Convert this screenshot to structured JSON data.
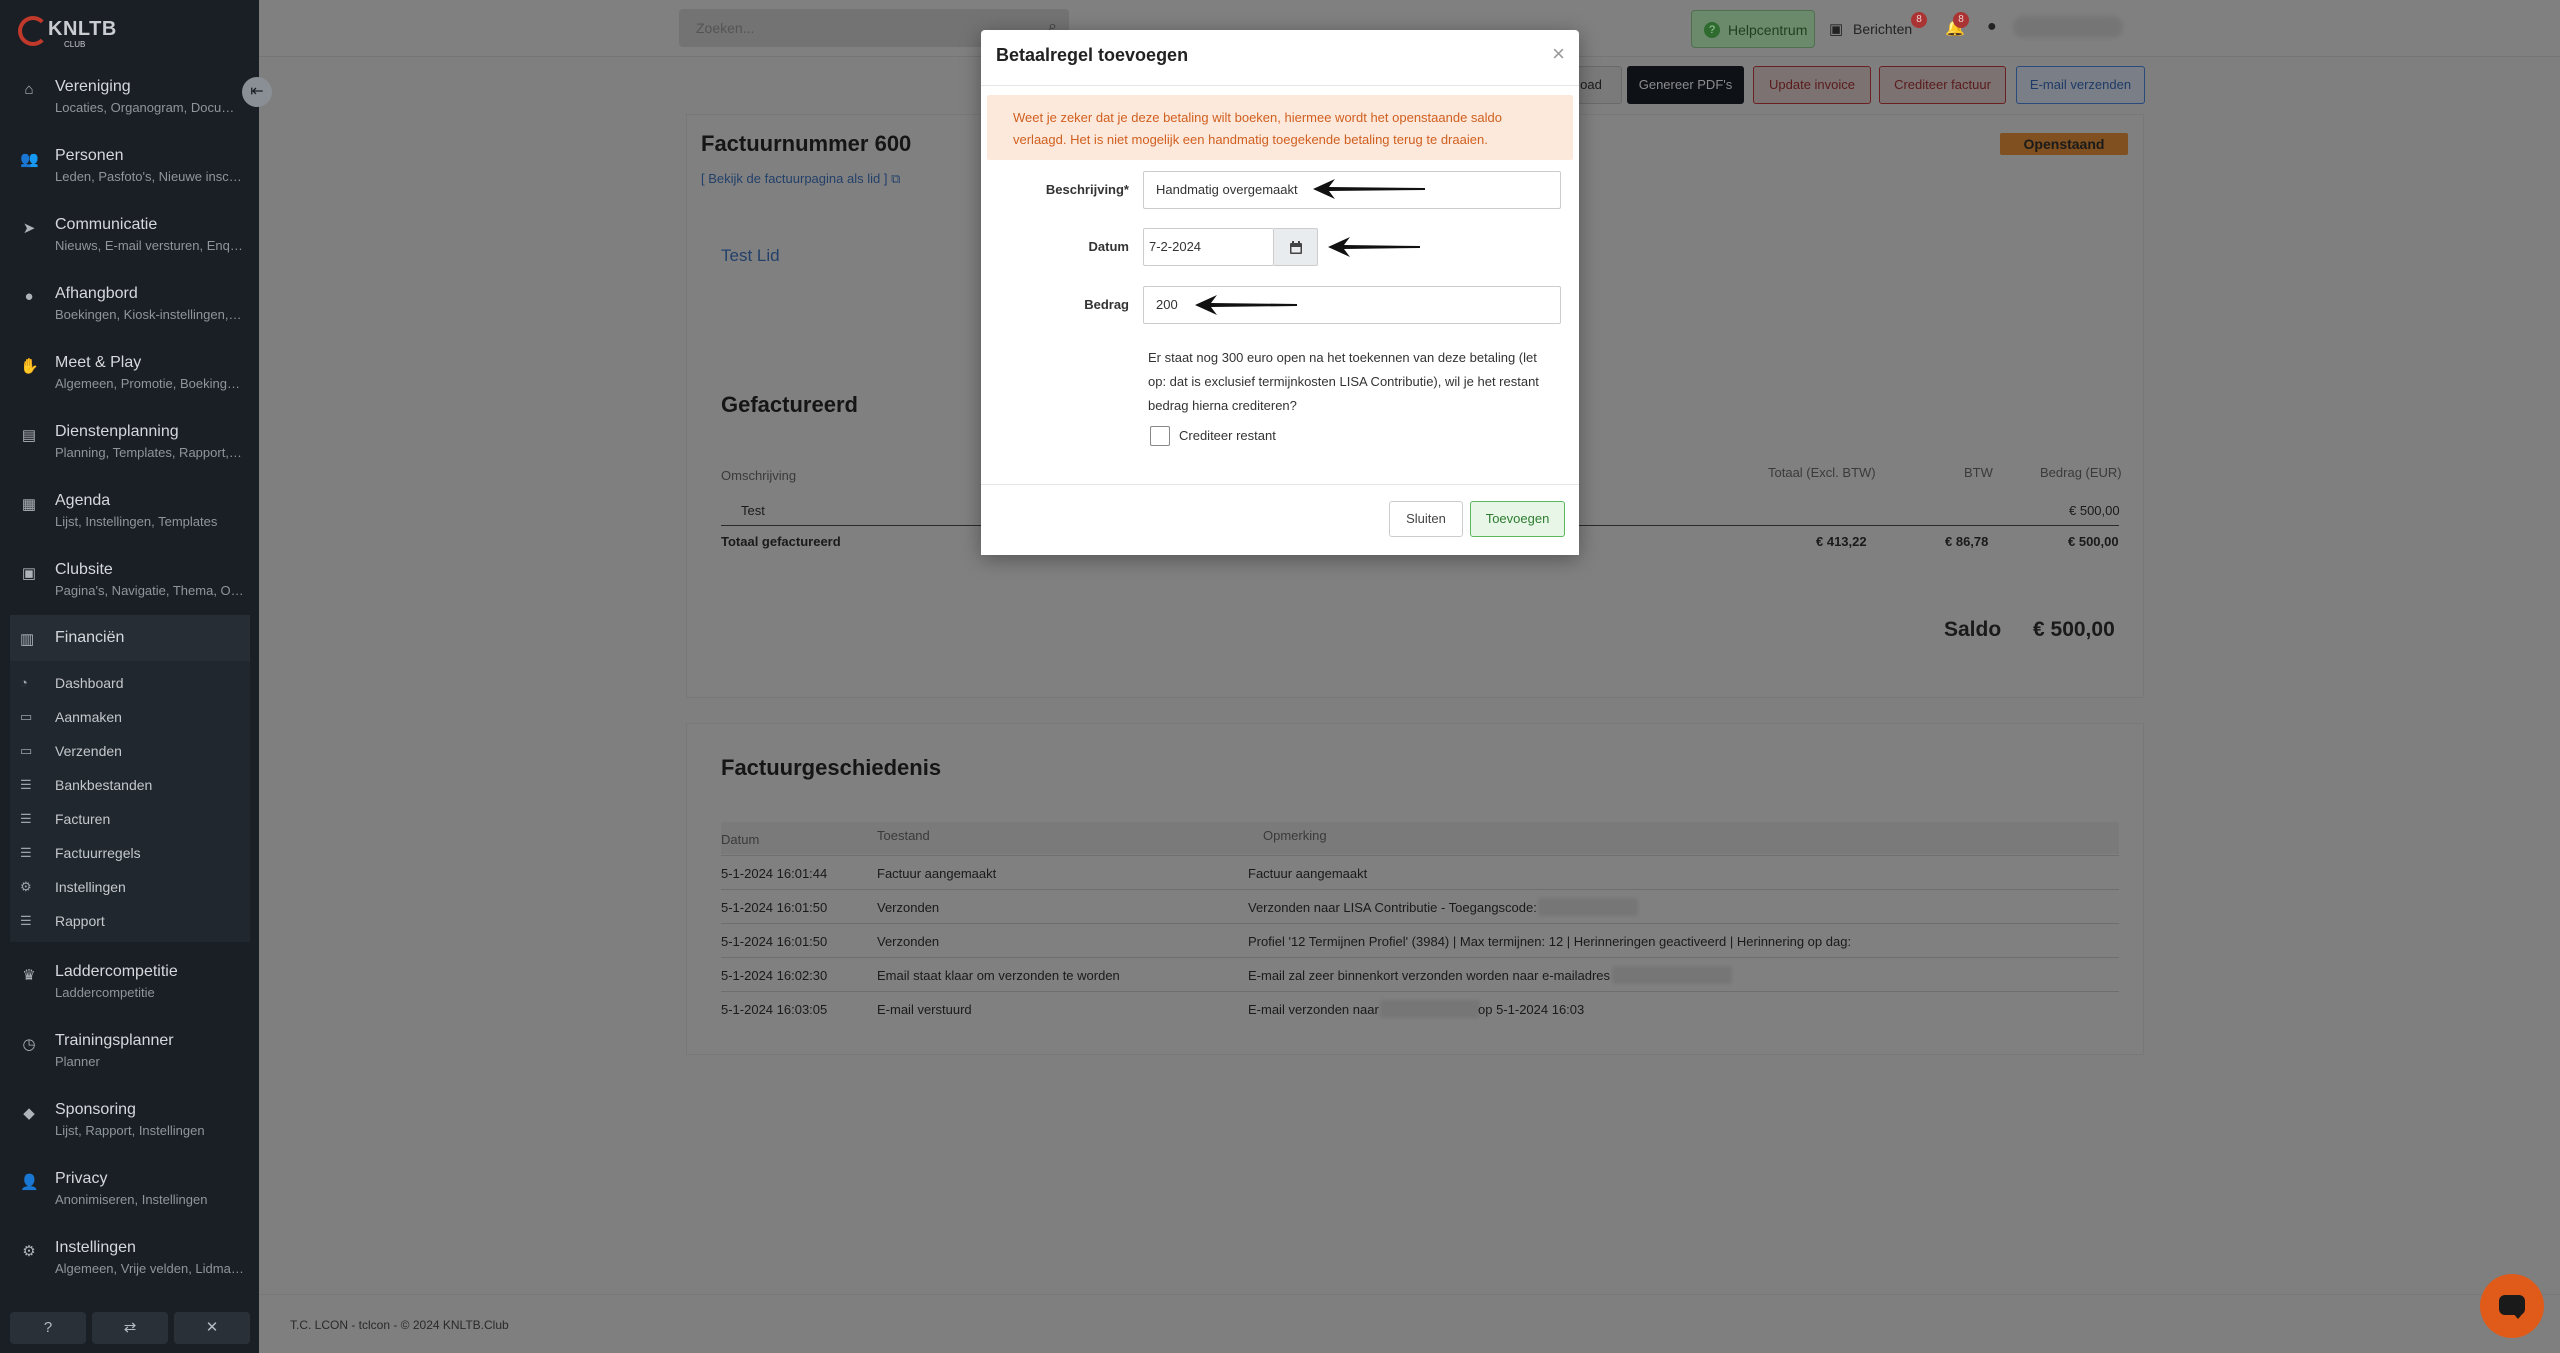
{
  "app": {
    "brand": "KNLTB",
    "brand_sub": "CLUB"
  },
  "sidebar": {
    "collapse_icon": "collapse-icon",
    "items": [
      {
        "title": "Vereniging",
        "subtitle": "Locaties, Organogram, Documenten",
        "icon": "home-icon"
      },
      {
        "title": "Personen",
        "subtitle": "Leden, Pasfoto's, Nieuwe inschrijvingen",
        "icon": "users-icon"
      },
      {
        "title": "Communicatie",
        "subtitle": "Nieuws, E-mail versturen, Enquêtes",
        "icon": "send-icon"
      },
      {
        "title": "Afhangbord",
        "subtitle": "Boekingen, Kiosk-instellingen, Banen",
        "icon": "ball-icon"
      },
      {
        "title": "Meet & Play",
        "subtitle": "Algemeen, Promotie, Boekingsinstellingen",
        "icon": "handshake-icon"
      },
      {
        "title": "Dienstenplanning",
        "subtitle": "Planning, Templates, Rapport, Instellingen",
        "icon": "id-card-icon"
      },
      {
        "title": "Agenda",
        "subtitle": "Lijst, Instellingen, Templates",
        "icon": "calendar-icon"
      },
      {
        "title": "Clubsite",
        "subtitle": "Pagina's, Navigatie, Thema, Opmaak",
        "icon": "browser-icon"
      }
    ],
    "finance": {
      "title": "Financiën",
      "items": [
        "Dashboard",
        "Aanmaken",
        "Verzenden",
        "Bankbestanden",
        "Facturen",
        "Factuurregels",
        "Instellingen",
        "Rapport"
      ]
    },
    "items_bottom": [
      {
        "title": "Laddercompetitie",
        "subtitle": "Laddercompetitie",
        "icon": "trophy-icon"
      },
      {
        "title": "Trainingsplanner",
        "subtitle": "Planner",
        "icon": "clock-icon"
      },
      {
        "title": "Sponsoring",
        "subtitle": "Lijst, Rapport, Instellingen",
        "icon": "gem-icon"
      },
      {
        "title": "Privacy",
        "subtitle": "Anonimiseren, Instellingen",
        "icon": "user-lock-icon"
      },
      {
        "title": "Instellingen",
        "subtitle": "Algemeen, Vrije velden, Lidmaatschappen",
        "icon": "sliders-icon"
      }
    ]
  },
  "topbar": {
    "search_placeholder": "Zoeken...",
    "help": "Helpcentrum",
    "messages": "Berichten",
    "messages_count": "8",
    "notifications_count": "8"
  },
  "actions": {
    "download": "oad",
    "generate_pdf": "Genereer PDF's",
    "update_invoice": "Update invoice",
    "credit_invoice": "Crediteer factuur",
    "send_email": "E-mail verzenden"
  },
  "invoice": {
    "number_title": "Factuurnummer 600",
    "view_link": "[ Bekijk de factuurpagina als lid ]",
    "status": "Openstaand",
    "member": "Test Lid",
    "billed_title": "Gefactureerd",
    "columns": [
      "Omschrijving",
      "Totaal (Excl. BTW)",
      "BTW",
      "Bedrag (EUR)"
    ],
    "line": {
      "description": "Test",
      "amount": "€ 500,00"
    },
    "total": {
      "label": "Totaal gefactureerd",
      "excl": "€ 413,22",
      "vat": "€ 86,78",
      "amount": "€ 500,00"
    },
    "saldo_label": "Saldo",
    "saldo_value": "€ 500,00"
  },
  "history": {
    "title": "Factuurgeschiedenis",
    "columns": [
      "Datum",
      "Toestand",
      "Opmerking"
    ],
    "rows": [
      {
        "date": "5-1-2024 16:01:44",
        "state": "Factuur aangemaakt",
        "note": "Factuur aangemaakt"
      },
      {
        "date": "5-1-2024 16:01:50",
        "state": "Verzonden",
        "note": "Verzonden naar LISA Contributie - Toegangscode:"
      },
      {
        "date": "5-1-2024 16:01:50",
        "state": "Verzonden",
        "note": "Profiel '12 Termijnen Profiel' (3984) | Max termijnen: 12 | Herinneringen geactiveerd | Herinnering op dag:"
      },
      {
        "date": "5-1-2024 16:02:30",
        "state": "Email staat klaar om verzonden te worden",
        "note": "E-mail zal zeer binnenkort verzonden worden naar e-mailadres"
      },
      {
        "date": "5-1-2024 16:03:05",
        "state": "E-mail verstuurd",
        "note_a": "E-mail verzonden naar",
        "note_b": "op 5-1-2024 16:03"
      }
    ]
  },
  "footer": "T.C. LCON - tclcon - © 2024 KNLTB.Club",
  "modal": {
    "title": "Betaalregel toevoegen",
    "alert": "Weet je zeker dat je deze betaling wilt boeken, hiermee wordt het openstaande saldo verlaagd. Het is niet mogelijk een handmatig toegekende betaling terug te draaien.",
    "description_label": "Beschrijving*",
    "description_value": "Handmatig overgemaakt",
    "date_label": "Datum",
    "date_value": "7-2-2024",
    "amount_label": "Bedrag",
    "amount_value": "200",
    "info": "Er staat nog 300 euro open na het toekennen van deze betaling (let op: dat is exclusief termijnkosten LISA Contributie), wil je het restant bedrag hierna crediteren?",
    "checkbox_label": "Crediteer restant",
    "checkbox_checked": false,
    "close_button": "Sluiten",
    "add_button": "Toevoegen"
  }
}
